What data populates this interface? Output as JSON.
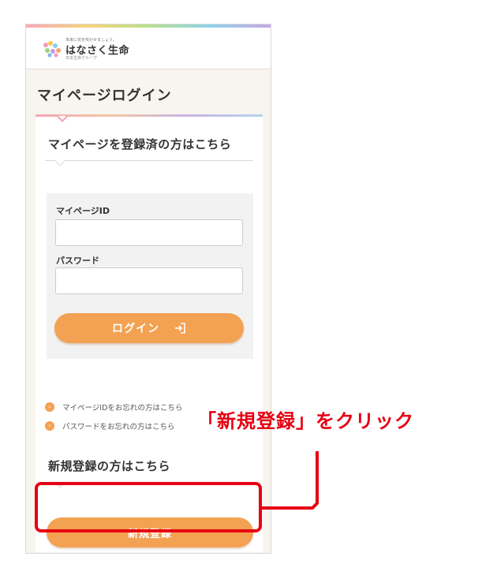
{
  "brand": {
    "tagline": "未来に花を咲かせましょう。",
    "name": "はなさく生命",
    "group": "日本生命グループ"
  },
  "page": {
    "title": "マイページログイン"
  },
  "login_section": {
    "heading": "マイページを登録済の方はこちら",
    "id_label": "マイページID",
    "id_value": "",
    "password_label": "パスワード",
    "password_value": "",
    "login_button": "ログイン",
    "login_icon": "enter-arrow-icon"
  },
  "links": [
    {
      "label": "マイページIDをお忘れの方はこちら",
      "icon": "chevron-right-circle-icon"
    },
    {
      "label": "パスワードをお忘れの方はこちら",
      "icon": "chevron-right-circle-icon"
    }
  ],
  "register_section": {
    "heading": "新規登録の方はこちら",
    "register_button": "新規登録"
  },
  "annotation": {
    "text": "「新規登録」をクリック",
    "color": "#e60012"
  },
  "colors": {
    "accent": "#f3a152",
    "background": "#f8f5ee",
    "annotation": "#e60012"
  }
}
